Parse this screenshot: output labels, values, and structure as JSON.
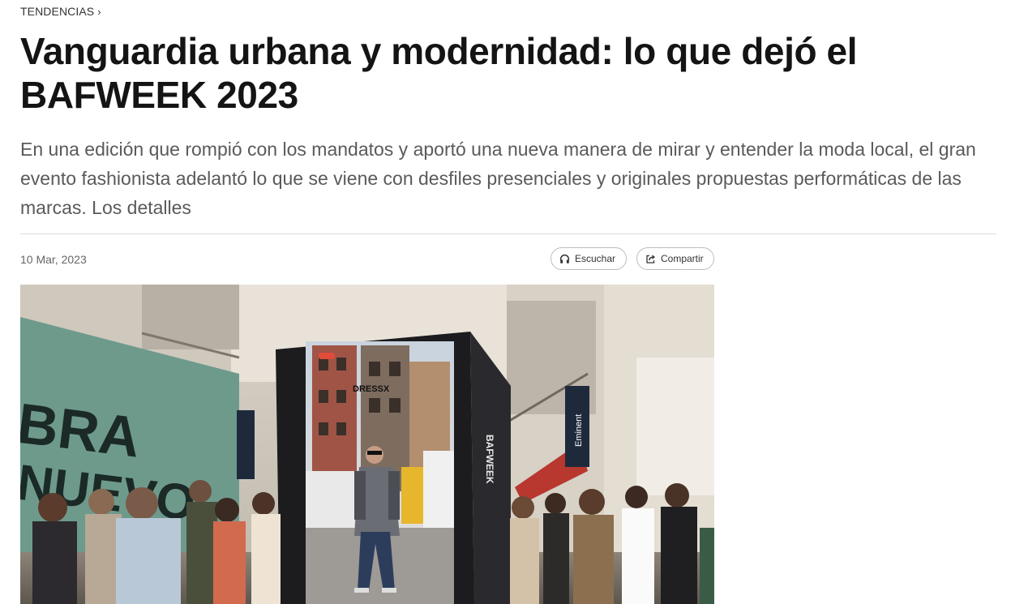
{
  "section": {
    "label": "TENDENCIAS",
    "chevron": "›"
  },
  "article": {
    "title": "Vanguardia urbana y modernidad: lo que dejó el BAFWEEK 2023",
    "subtitle": "En una edición que rompió con los mandatos y aportó una nueva manera de mirar y entender la moda local, el gran evento fashionista adelantó lo que se viene con desfiles presenciales y originales propuestas performáticas de las marcas. Los detalles",
    "date": "10 Mar, 2023"
  },
  "actions": {
    "listen_label": "Escuchar",
    "listen_icon": "headphones-icon",
    "share_label": "Compartir",
    "share_icon": "share-icon"
  },
  "photo": {
    "signage": {
      "mural_text_1": "BRA",
      "mural_text_2": "NUEVO",
      "screen_brand": "DRESSX",
      "kiosk_side_text": "BAFWEEK",
      "banner_text": "Eminent"
    }
  },
  "colors": {
    "title": "#141414",
    "subtitle": "#5a5a5a",
    "mural": "#6e9a8c"
  }
}
